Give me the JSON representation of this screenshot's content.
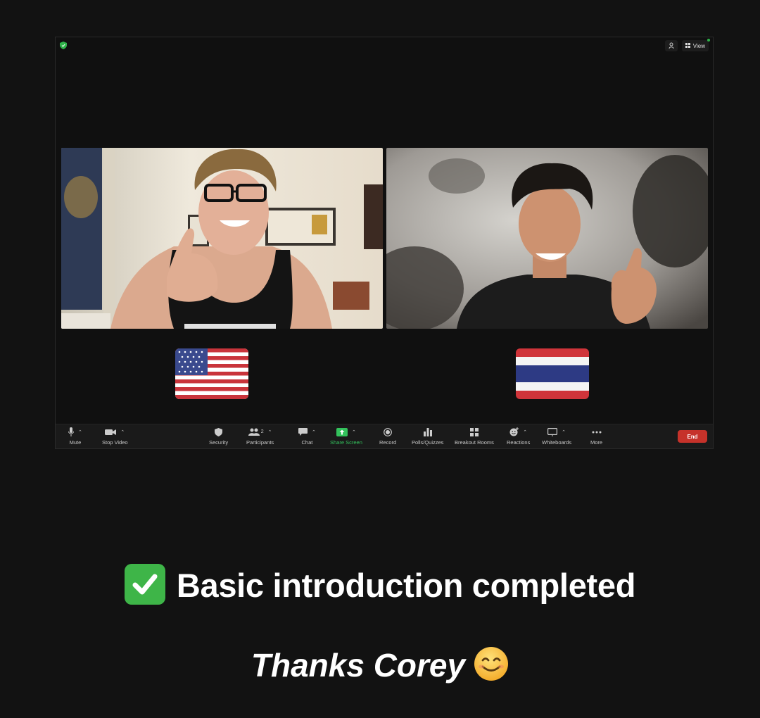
{
  "topbar": {
    "view_label": "View"
  },
  "participants_count": "2",
  "toolbar": {
    "mute": "Mute",
    "stop_video": "Stop Video",
    "security": "Security",
    "participants": "Participants",
    "chat": "Chat",
    "share_screen": "Share Screen",
    "record": "Record",
    "polls": "Polls/Quizzes",
    "breakout": "Breakout Rooms",
    "reactions": "Reactions",
    "whiteboards": "Whiteboards",
    "more": "More",
    "end": "End"
  },
  "captions": {
    "line1": "Basic introduction completed",
    "line2": "Thanks Corey"
  },
  "colors": {
    "end": "#c6322a",
    "share": "#33c25c",
    "check": "#3eb548"
  },
  "icons": [
    "shield-icon",
    "grid-icon",
    "mic-icon",
    "camera-icon",
    "people-icon",
    "chat-icon",
    "share-icon",
    "record-icon",
    "polls-icon",
    "breakout-icon",
    "reactions-icon",
    "whiteboard-icon",
    "more-icon",
    "check-icon",
    "smile-icon"
  ]
}
